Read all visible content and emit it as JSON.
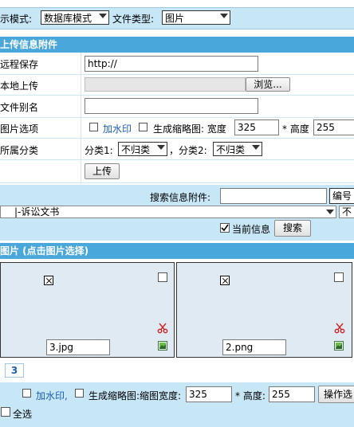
{
  "top": {
    "mode_label": "示模式:",
    "mode_value": "数据库模式",
    "filetype_label": "文件类型:",
    "filetype_value": "图片"
  },
  "upload": {
    "section_title": "上传信息附件",
    "remote_label": "远程保存",
    "remote_value": "http://",
    "local_label": "本地上传",
    "browse_label": "浏览...",
    "alias_label": "文件别名",
    "alias_value": "",
    "image_opts_label": "图片选项",
    "watermark_label": "加水印",
    "thumb_label": "生成缩略图: 宽度",
    "width_value": "325",
    "height_label": "* 高度",
    "height_value": "255",
    "category_label": "所属分类",
    "cat1_label": "分类1:",
    "cat1_value": "不归类",
    "cat2_label": "，分类2:",
    "cat2_value": "不归类",
    "upload_button": "上传"
  },
  "search": {
    "label": "搜索信息附件:",
    "value": "",
    "field_select": "编号",
    "category_value": "|-诉讼文书",
    "category_extra": "不",
    "current_label": "当前信息",
    "current_checked": true,
    "search_button": "搜索"
  },
  "gallery": {
    "section_title": "图片 (点击图片选择)",
    "items": [
      {
        "name": "3.jpg"
      },
      {
        "name": "2.png"
      }
    ],
    "page": "3"
  },
  "bottom": {
    "watermark_label": "加水印,",
    "thumb_label": "生成缩略图:缩图宽度:",
    "width_value": "325",
    "height_label": "* 高度:",
    "height_value": "255",
    "op_button": "操作选",
    "select_all_label": "全选"
  },
  "colors": {
    "section_bg": "#4aa7db",
    "row_bg": "#c7e6f6",
    "card_bg": "#dfeaf3",
    "link_blue": "#1a5fb4",
    "delete_red": "#d02020"
  }
}
